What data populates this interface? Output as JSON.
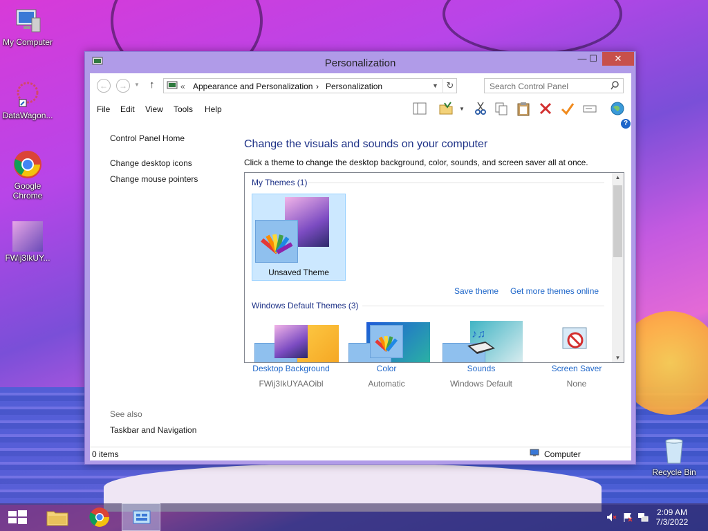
{
  "desktop": {
    "icons": [
      {
        "label": "My Computer"
      },
      {
        "label": "DataWagon..."
      },
      {
        "label": "Google Chrome"
      },
      {
        "label": "FWij3IkUY..."
      },
      {
        "label": "Recycle Bin"
      }
    ]
  },
  "window": {
    "title": "Personalization",
    "controls": {
      "minimize": "—",
      "maximize": "☐",
      "close": "✕"
    }
  },
  "nav": {
    "back": "←",
    "forward": "→",
    "up": "↑",
    "breadcrumb_sep": "«",
    "crumb1": "Appearance and Personalization",
    "crumb_arrow": "›",
    "crumb2": "Personalization",
    "search_placeholder": "Search Control Panel"
  },
  "menu": [
    "File",
    "Edit",
    "View",
    "Tools",
    "Help"
  ],
  "sidebar": {
    "home": "Control Panel Home",
    "links": [
      "Change desktop icons",
      "Change mouse pointers"
    ],
    "see_also": "See also",
    "see_also_links": [
      "Taskbar and Navigation"
    ]
  },
  "main": {
    "title": "Change the visuals and sounds on your computer",
    "description": "Click a theme to change the desktop background, color, sounds, and screen saver all at once.",
    "my_themes_header": "My Themes (1)",
    "unsaved_theme": "Unsaved Theme",
    "save_theme": "Save theme",
    "get_more": "Get more themes online",
    "default_themes_header": "Windows Default Themes (3)"
  },
  "bottom": [
    {
      "title": "Desktop Background",
      "value": "FWij3IkUYAAOibl"
    },
    {
      "title": "Color",
      "value": "Automatic"
    },
    {
      "title": "Sounds",
      "value": "Windows Default"
    },
    {
      "title": "Screen Saver",
      "value": "None"
    }
  ],
  "status": {
    "items": "0 items",
    "location": "Computer"
  },
  "taskbar": {
    "time": "2:09 AM",
    "date": "7/3/2022"
  },
  "colors": {
    "accent": "#b09be8",
    "link": "#1e66c9",
    "title": "#1e3287",
    "selection": "#cce8ff"
  }
}
